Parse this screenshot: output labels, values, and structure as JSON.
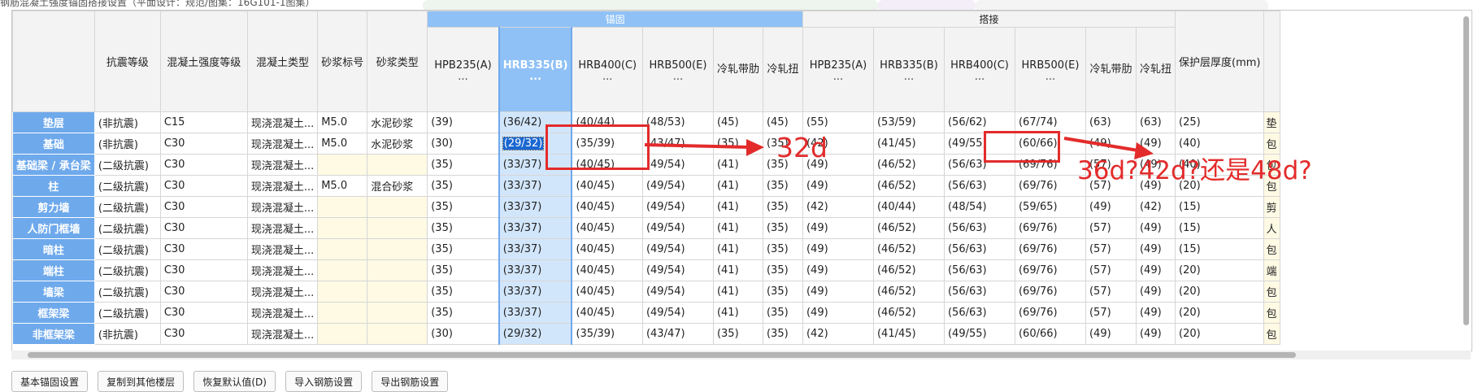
{
  "window": {
    "partial_title": "钢筋混凝土强度锚固搭接设置（平面设计：规范/图集：16G101-1图集）"
  },
  "colors": {
    "header_blue": "#8fc1f6",
    "rowhead_blue": "#6ea9ec",
    "annotation_red": "#e32b2b",
    "yellow_cell": "#fefae4"
  },
  "groups": {
    "anchor": "锚固",
    "lap": "搭接"
  },
  "columns": {
    "seismic": "抗震等级",
    "concrete_grade": "混凝土强度等级",
    "concrete_type": "混凝土类型",
    "mortar_grade": "砂浆标号",
    "mortar_type": "砂浆类型",
    "a_hpb235": "HPB235(A)",
    "a_hrb335": "HRB335(B)",
    "a_hrb400": "HRB400(C)",
    "a_hrb500": "HRB500(E)",
    "a_crb": "冷轧带肋",
    "a_ctb": "冷轧扭",
    "l_hpb235": "HPB235(A)",
    "l_hrb335": "HRB335(B)",
    "l_hrb400": "HRB400(C)",
    "l_hrb500": "HRB500(E)",
    "l_crb": "冷轧带肋",
    "l_ctb": "冷轧扭",
    "cover": "保护层厚度(mm)",
    "dots": "..."
  },
  "rows": [
    {
      "name": "垫层",
      "seismic": "(非抗震)",
      "cg": "C15",
      "ct": "现浇混凝土...",
      "mg": "M5.0",
      "mt": "水泥砂浆",
      "a1": "(39)",
      "a2": "(36/42)",
      "a3": "(40/44)",
      "a4": "(48/53)",
      "a5": "(45)",
      "a6": "(45)",
      "l1": "(55)",
      "l2": "(53/59)",
      "l3": "(56/62)",
      "l4": "(67/74)",
      "l5": "(63)",
      "l6": "(63)",
      "cover": "(25)",
      "note": "垫"
    },
    {
      "name": "基础",
      "seismic": "(非抗震)",
      "cg": "C30",
      "ct": "现浇混凝土...",
      "mg": "M5.0",
      "mt": "水泥砂浆",
      "a1": "(30)",
      "a2": "(29/32)",
      "a3": "(35/39)",
      "a4": "(43/47)",
      "a5": "(35)",
      "a6": "(35)",
      "l1": "(42)",
      "l2": "(41/45)",
      "l3": "(49/55)",
      "l4": "(60/66)",
      "l5": "(49)",
      "l6": "(49)",
      "cover": "(40)",
      "note": "包"
    },
    {
      "name": "基础梁 / 承台梁",
      "seismic": "(二级抗震)",
      "cg": "C30",
      "ct": "现浇混凝土...",
      "mg": "",
      "mt": "",
      "a1": "(35)",
      "a2": "(33/37)",
      "a3": "(40/45)",
      "a4": "(49/54)",
      "a5": "(41)",
      "a6": "(35)",
      "l1": "(49)",
      "l2": "(46/52)",
      "l3": "(56/63)",
      "l4": "(69/76)",
      "l5": "(57)",
      "l6": "(49)",
      "cover": "(40)",
      "note": "包"
    },
    {
      "name": "柱",
      "seismic": "(二级抗震)",
      "cg": "C30",
      "ct": "现浇混凝土...",
      "mg": "M5.0",
      "mt": "混合砂浆",
      "a1": "(35)",
      "a2": "(33/37)",
      "a3": "(40/45)",
      "a4": "(49/54)",
      "a5": "(41)",
      "a6": "(35)",
      "l1": "(49)",
      "l2": "(46/52)",
      "l3": "(56/63)",
      "l4": "(69/76)",
      "l5": "(57)",
      "l6": "(49)",
      "cover": "(20)",
      "note": "包"
    },
    {
      "name": "剪力墙",
      "seismic": "(二级抗震)",
      "cg": "C30",
      "ct": "现浇混凝土...",
      "mg": "",
      "mt": "",
      "a1": "(35)",
      "a2": "(33/37)",
      "a3": "(40/45)",
      "a4": "(49/54)",
      "a5": "(41)",
      "a6": "(35)",
      "l1": "(42)",
      "l2": "(40/44)",
      "l3": "(48/54)",
      "l4": "(59/65)",
      "l5": "(49)",
      "l6": "(42)",
      "cover": "(15)",
      "note": "剪"
    },
    {
      "name": "人防门框墙",
      "seismic": "(二级抗震)",
      "cg": "C30",
      "ct": "现浇混凝土...",
      "mg": "",
      "mt": "",
      "a1": "(35)",
      "a2": "(33/37)",
      "a3": "(40/45)",
      "a4": "(49/54)",
      "a5": "(41)",
      "a6": "(35)",
      "l1": "(49)",
      "l2": "(46/52)",
      "l3": "(56/63)",
      "l4": "(69/76)",
      "l5": "(57)",
      "l6": "(49)",
      "cover": "(15)",
      "note": "人"
    },
    {
      "name": "暗柱",
      "seismic": "(二级抗震)",
      "cg": "C30",
      "ct": "现浇混凝土...",
      "mg": "",
      "mt": "",
      "a1": "(35)",
      "a2": "(33/37)",
      "a3": "(40/45)",
      "a4": "(49/54)",
      "a5": "(41)",
      "a6": "(35)",
      "l1": "(49)",
      "l2": "(46/52)",
      "l3": "(56/63)",
      "l4": "(69/76)",
      "l5": "(57)",
      "l6": "(49)",
      "cover": "(15)",
      "note": "包"
    },
    {
      "name": "端柱",
      "seismic": "(二级抗震)",
      "cg": "C30",
      "ct": "现浇混凝土...",
      "mg": "",
      "mt": "",
      "a1": "(35)",
      "a2": "(33/37)",
      "a3": "(40/45)",
      "a4": "(49/54)",
      "a5": "(41)",
      "a6": "(35)",
      "l1": "(49)",
      "l2": "(46/52)",
      "l3": "(56/63)",
      "l4": "(69/76)",
      "l5": "(57)",
      "l6": "(49)",
      "cover": "(20)",
      "note": "端"
    },
    {
      "name": "墙梁",
      "seismic": "(二级抗震)",
      "cg": "C30",
      "ct": "现浇混凝土...",
      "mg": "",
      "mt": "",
      "a1": "(35)",
      "a2": "(33/37)",
      "a3": "(40/45)",
      "a4": "(49/54)",
      "a5": "(41)",
      "a6": "(35)",
      "l1": "(49)",
      "l2": "(46/52)",
      "l3": "(56/63)",
      "l4": "(69/76)",
      "l5": "(57)",
      "l6": "(49)",
      "cover": "(20)",
      "note": "包"
    },
    {
      "name": "框架梁",
      "seismic": "(二级抗震)",
      "cg": "C30",
      "ct": "现浇混凝土...",
      "mg": "",
      "mt": "",
      "a1": "(35)",
      "a2": "(33/37)",
      "a3": "(40/45)",
      "a4": "(49/54)",
      "a5": "(41)",
      "a6": "(35)",
      "l1": "(49)",
      "l2": "(46/52)",
      "l3": "(56/63)",
      "l4": "(69/76)",
      "l5": "(57)",
      "l6": "(49)",
      "cover": "(20)",
      "note": "包"
    },
    {
      "name": "非框架梁",
      "seismic": "(非抗震)",
      "cg": "C30",
      "ct": "现浇混凝土...",
      "mg": "",
      "mt": "",
      "a1": "(30)",
      "a2": "(29/32)",
      "a3": "(35/39)",
      "a4": "(43/47)",
      "a5": "(35)",
      "a6": "(35)",
      "l1": "(42)",
      "l2": "(41/45)",
      "l3": "(49/55)",
      "l4": "(60/66)",
      "l5": "(49)",
      "l6": "(49)",
      "cover": "(20)",
      "note": "包"
    }
  ],
  "annotations": {
    "left": "32d",
    "right": "36d?42d?还是48d?"
  },
  "buttons": [
    "基本锚固设置",
    "复制到其他楼层",
    "恢复默认值(D)",
    "导入钢筋设置",
    "导出钢筋设置"
  ]
}
